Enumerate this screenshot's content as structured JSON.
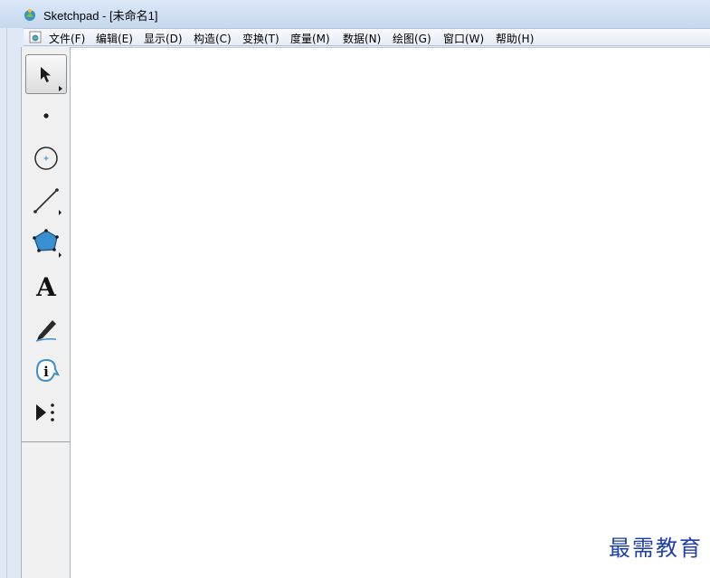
{
  "titlebar": {
    "title": "Sketchpad - [未命名1]"
  },
  "menubar": {
    "items": [
      {
        "label": "文件(F)"
      },
      {
        "label": "编辑(E)"
      },
      {
        "label": "显示(D)"
      },
      {
        "label": "构造(C)"
      },
      {
        "label": "变换(T)"
      },
      {
        "label": "度量(M)"
      },
      {
        "label": "数据(N)"
      },
      {
        "label": "绘图(G)"
      },
      {
        "label": "窗口(W)"
      },
      {
        "label": "帮助(H)"
      }
    ]
  },
  "toolbox": {
    "tools": [
      {
        "icon": "arrow-select-icon",
        "selected": true
      },
      {
        "icon": "point-icon"
      },
      {
        "icon": "compass-circle-icon"
      },
      {
        "icon": "straightedge-icon"
      },
      {
        "icon": "polygon-icon"
      },
      {
        "icon": "text-icon",
        "glyph": "A"
      },
      {
        "icon": "marker-pen-icon"
      },
      {
        "icon": "information-icon",
        "glyph": "i"
      },
      {
        "icon": "custom-tool-icon"
      }
    ]
  },
  "watermark": {
    "text": "最需教育"
  },
  "colors": {
    "title_bg": "#c6d8ee",
    "polygon_fill": "#3a8fd0",
    "info_accent": "#3e8fc4",
    "watermark": "#1f3fa8"
  }
}
